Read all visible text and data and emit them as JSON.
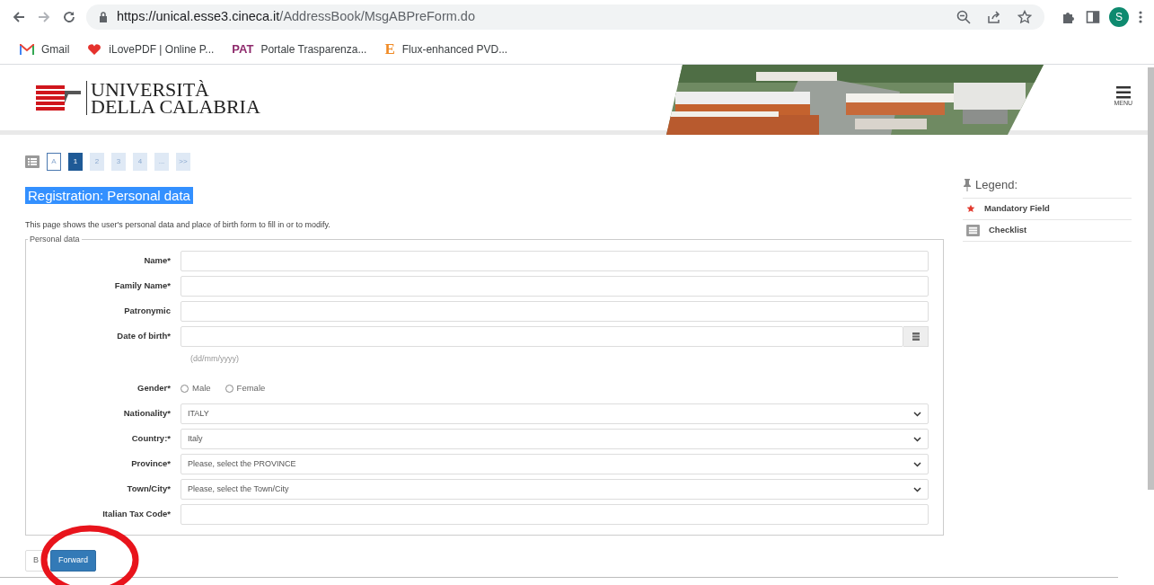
{
  "browser": {
    "url_host": "https://unical.esse3.cineca.it",
    "url_path": "/AddressBook/MsgABPreForm.do",
    "profile_initial": "S",
    "bookmarks": [
      {
        "label": "Gmail",
        "kind": "gmail"
      },
      {
        "label": "iLovePDF | Online P...",
        "kind": "heart"
      },
      {
        "label": "Portale Trasparenza...",
        "kind": "pat",
        "badge": "PAT"
      },
      {
        "label": "Flux-enhanced PVD...",
        "kind": "letter",
        "badge": "E"
      }
    ]
  },
  "header": {
    "logo_line_1": "UNIVERSITÀ",
    "logo_line_2": "DELLA CALABRIA",
    "menu_label": "MENU"
  },
  "steps": [
    {
      "label": "A",
      "kind": "outline",
      "selected": false
    },
    {
      "label": "1",
      "kind": "page",
      "selected": true
    },
    {
      "label": "2",
      "kind": "page",
      "selected": false
    },
    {
      "label": "3",
      "kind": "page",
      "selected": false
    },
    {
      "label": "4",
      "kind": "page",
      "selected": false
    },
    {
      "label": "...",
      "kind": "page",
      "selected": false
    },
    {
      "label": ">>",
      "kind": "page",
      "selected": false
    }
  ],
  "title": "Registration: Personal data",
  "description": "This page shows the user's personal data and place of birth form to fill in or to modify.",
  "fieldset": {
    "legend": "Personal data",
    "fields": [
      {
        "label": "Name*",
        "kind": "text"
      },
      {
        "label": "Family Name*",
        "kind": "text"
      },
      {
        "label": "Patronymic",
        "kind": "text"
      },
      {
        "label": "Date of birth*",
        "kind": "date",
        "hint": "(dd/mm/yyyy)"
      },
      {
        "label": "Gender*",
        "kind": "radio",
        "options": [
          {
            "label": "Male",
            "checked": false
          },
          {
            "label": "Female",
            "checked": false
          }
        ]
      },
      {
        "label": "Nationality*",
        "kind": "select",
        "value": "ITALY"
      },
      {
        "label": "Country:*",
        "kind": "select",
        "value": "Italy"
      },
      {
        "label": "Province*",
        "kind": "select",
        "value": "Please, select the PROVINCE"
      },
      {
        "label": "Town/City*",
        "kind": "select",
        "value": "Please, select the Town/City"
      },
      {
        "label": "Italian Tax Code*",
        "kind": "text"
      }
    ]
  },
  "legend": {
    "title": "Legend:",
    "items": [
      {
        "label": "Mandatory Field",
        "kind": "star"
      },
      {
        "label": "Checklist",
        "kind": "list"
      }
    ]
  },
  "buttons": [
    {
      "label": "B",
      "kind": "secondary"
    },
    {
      "label": "Forward",
      "kind": "primary"
    }
  ]
}
